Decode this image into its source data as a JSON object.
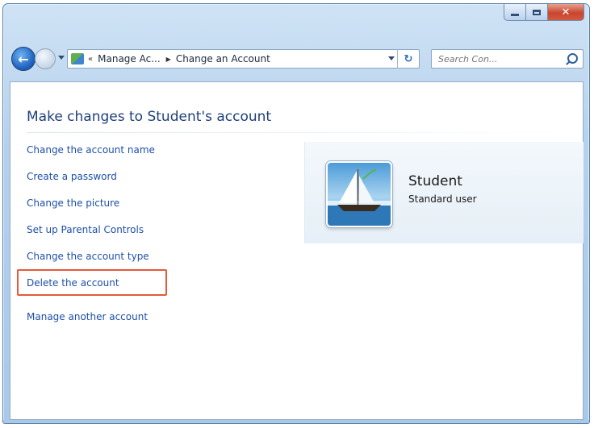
{
  "window": {
    "caption_buttons": {
      "minimize_icon": "minimize-icon",
      "maximize_icon": "maximize-icon",
      "close_icon": "close-icon",
      "close_glyph": "✕"
    }
  },
  "nav": {
    "back_glyph": "←",
    "address": {
      "chevron": "«",
      "segments": [
        "Manage Ac...",
        "Change an Account"
      ],
      "separator": "▶",
      "refresh_glyph": "↻"
    },
    "search": {
      "placeholder": "Search Con..."
    }
  },
  "main": {
    "title": "Make changes to Student's account",
    "links": [
      "Change the account name",
      "Create a password",
      "Change the picture",
      "Set up Parental Controls",
      "Change the account type",
      "Delete the account",
      "Manage another account"
    ],
    "highlighted_link": "Delete the account"
  },
  "user": {
    "name": "Student",
    "type": "Standard user",
    "picture_icon": "sailboat-picture"
  },
  "colors": {
    "link": "#1e4fa8",
    "title": "#1f3f7a",
    "highlight_border": "#e45a3b",
    "window_frame": "#b4d0ec"
  }
}
